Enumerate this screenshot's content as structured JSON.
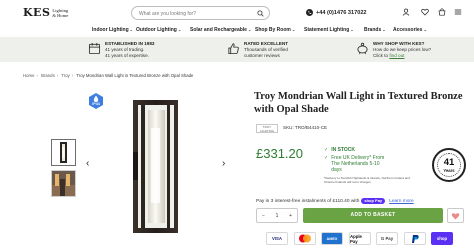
{
  "header": {
    "logo_main": "KES",
    "logo_sub_1": "Lighting",
    "logo_sub_2": "& Home",
    "search_placeholder": "What are you looking for?",
    "phone": "+44 (0)1476 317022"
  },
  "nav": {
    "items": [
      {
        "label": "Indoor Lighting"
      },
      {
        "label": "Outdoor Lighting"
      },
      {
        "label": "Solar and Rechargeable"
      },
      {
        "label": "Shop By Room"
      },
      {
        "label": "Statement Lighting"
      },
      {
        "label": "Brands"
      },
      {
        "label": "Accessories"
      }
    ]
  },
  "info": {
    "established": {
      "title": "ESTABLISHED IN 1983",
      "line1": "41 years of trading.",
      "line2": "41 years of expertise."
    },
    "rated": {
      "title": "RATED EXCELLENT",
      "line1": "Thousands of verified",
      "line2": "customer reviews"
    },
    "why": {
      "title": "WHY SHOP WITH KES?",
      "line1": "How do we keep prices low?",
      "line2_prefix": "Click to ",
      "line2_link": "find out"
    }
  },
  "breadcrumb": {
    "items": [
      "Home",
      "Brands",
      "Troy"
    ],
    "current": "Troy Mondrian Wall Light in Textured Bronze with Opal Shade"
  },
  "product": {
    "ip_badge": "IP44",
    "title": "Troy Mondrian Wall Light in Textured Bronze with Opal Shade",
    "brand_logo_text": "TROY LIGHTING",
    "sku": "SKU: TRO/B4410-CE",
    "price": "£331.20",
    "stock": "IN STOCK",
    "delivery_1": "Free UK Delivery* From",
    "delivery_2": "The Netherlands 5-10",
    "delivery_3": "days",
    "delivery_note": "*Delivery to Scottish Highlands & Islands, Northern Ireland and Channel Islands will incur charges",
    "badge_years": "41",
    "badge_label": "Years",
    "klarna_prefix": "Pay in 3 interest-free instalments of £110.40 with",
    "shoppay": "shop Pay",
    "learn_more": "Learn more",
    "qty_minus": "−",
    "qty_value": "1",
    "qty_plus": "+",
    "add_to_basket": "ADD TO BASKET"
  },
  "payments": [
    "VISA",
    "Mastercard",
    "AMEX",
    "Apple Pay",
    "G Pay",
    "PayPal",
    "shop"
  ],
  "colors": {
    "accent_green": "#6aa343",
    "price_green": "#2e7d32",
    "info_bg": "#eef0ec",
    "shoppay_purple": "#5a31f4"
  }
}
